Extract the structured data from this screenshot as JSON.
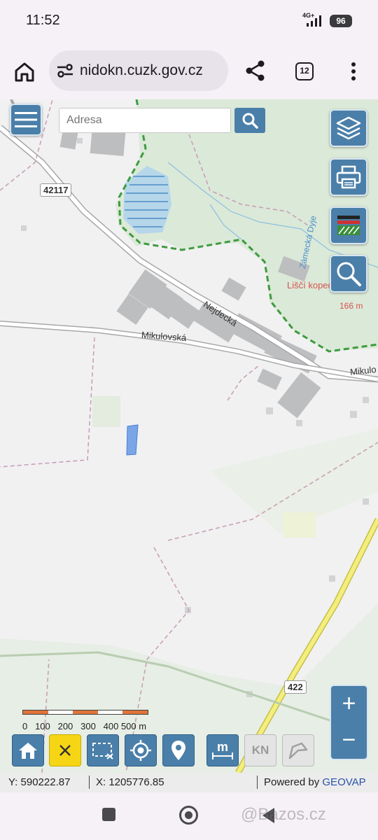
{
  "status": {
    "time": "11:52",
    "network": "4G+",
    "battery": "96"
  },
  "browser": {
    "url": "nidokn.cuzk.gov.cz",
    "tab_count": "12"
  },
  "search": {
    "placeholder": "Adresa"
  },
  "map": {
    "labels": {
      "road_42117": "42117",
      "nejdecka": "Nejdecká",
      "mikulovska": "Mikulovská",
      "mikulo": "Mikulo",
      "zamecka_dyje": "Zámecká Dyje",
      "lisci_kopec": "Liščí kopec",
      "elevation": "166 m",
      "road_422": "422"
    },
    "scale": {
      "labels": "0   100   200   300   400 500 m"
    }
  },
  "toolbar": {
    "kn_label": "KN"
  },
  "icons": [
    "menu-icon",
    "search-icon",
    "layers-icon",
    "print-icon",
    "legend-icon",
    "zoom-search-icon",
    "home-icon",
    "close-icon",
    "select-area-icon",
    "locate-icon",
    "pin-icon",
    "measure-icon",
    "polygon-icon"
  ],
  "coords": {
    "y": "Y: 590222.87",
    "x": "X: 1205776.85",
    "powered_prefix": "Powered by ",
    "powered_brand": "GEOVAP"
  },
  "watermark": "@Bazos.cz",
  "colors": {
    "accent": "#4a7fa9",
    "cadastral_border": "#c8a0b8",
    "forest": "#dbe9d8",
    "highlight_parcel": "#7aa6e8"
  }
}
